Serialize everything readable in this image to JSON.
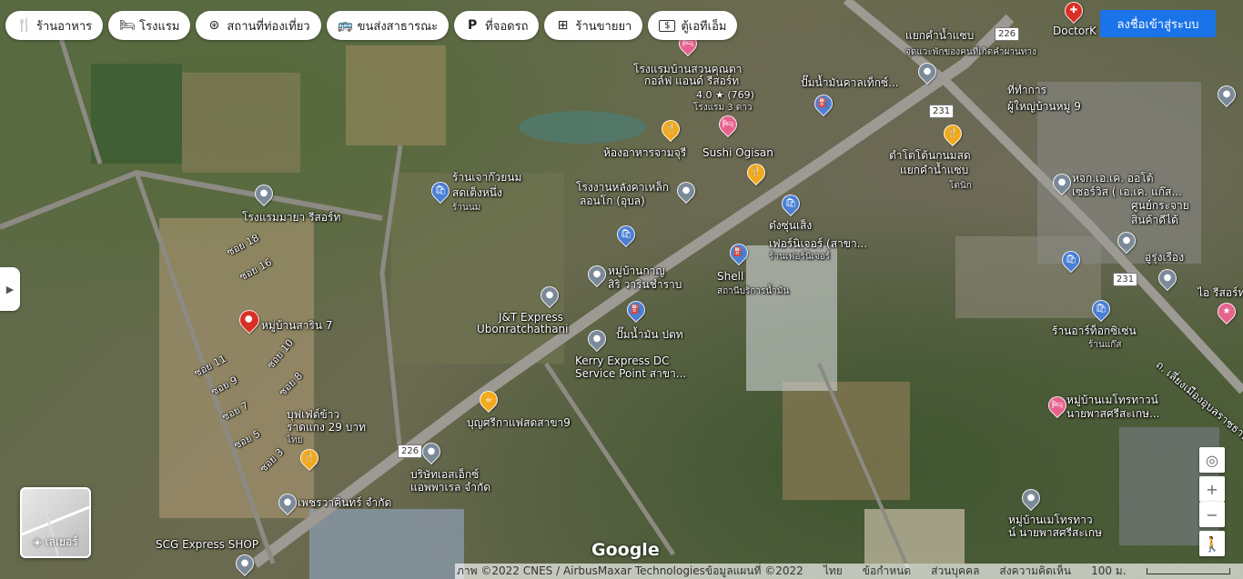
{
  "chips": [
    {
      "icon": "🍴",
      "label": "ร้านอาหาร",
      "name": "restaurant"
    },
    {
      "icon": "🛏",
      "label": "โรงแรม",
      "name": "hotel"
    },
    {
      "icon": "⊛",
      "label": "สถานที่ท่องเที่ยว",
      "name": "attractions"
    },
    {
      "icon": "🚌",
      "label": "ขนส่งสาธารณะ",
      "name": "transit"
    },
    {
      "icon": "P",
      "label": "ที่จอดรถ",
      "name": "parking"
    },
    {
      "icon": "⊞",
      "label": "ร้านขายยา",
      "name": "pharmacy"
    },
    {
      "icon": "$",
      "label": "ตู้เอทีเอ็ม",
      "name": "atm"
    }
  ],
  "signin_label": "ลงชื่อเข้าสู่ระบบ",
  "layers_label": "เลเยอร์",
  "google_logo": "Google",
  "attribution": {
    "imagery": "ภาพ ©2022 CNES / AirbusMaxar Technologiesข้อมูลแผนที่ ©2022",
    "lang": "ไทย",
    "terms": "ข้อกำหนด",
    "privacy": "ส่วนบุคคล",
    "feedback": "ส่งความคิดเห็น",
    "scale": "100 ม."
  },
  "shields": [
    "226",
    "231",
    "231",
    "226"
  ],
  "places": {
    "p1": "โรงแรมบ้านสวนคุณตา",
    "p1b": "กอล์ฟ แอนด์ รีสอร์ท",
    "p1c": "4.0 ★ (769)",
    "p1d": "โรงแรม 3 ดาว",
    "p2": "ห้องอาหารจามจุรี",
    "p3": "Sushi Ogisan",
    "p4": "ร้านเจาก๊วยนม",
    "p4b": "สดเต็งหนึ่ง",
    "p4c": "ร้านนม",
    "p5": "โรงงานหลังคาเหล็ก",
    "p5b": "ลอนโก (อุบล)",
    "p6": "โรงแรมมายา รีสอร์ท",
    "p7": "ต๋งซุ่นเส็ง",
    "p7b": "เฟอร์นิเจอร์ (สาขา...",
    "p7c": "ร้านเฟอร์นิเจอร์",
    "p8": "หมู่บ้านกาญ",
    "p8b": "สิริ วารินชำราบ",
    "p9": "Shell",
    "p9b": "สถานีบริการน้ำมัน",
    "p10": "J&T Express",
    "p10b": "Ubonratchathani",
    "p11": "ปั๊มน้ำมัน ปตท",
    "p12": "Kerry Express DC",
    "p12b": "Service Point สาขา...",
    "p13": "หมู่บ้านสาริน 7",
    "p14": "บุญศรีกาแฟสดสาขา9",
    "p15": "บุฟเฟ่ต์ข้าว",
    "p15b": "ราดแกง 29 บาท",
    "p15c": "ไทย",
    "p16": "บริษัทเอสเอ็กซ์",
    "p16b": "แอพพาเรล จำกัด",
    "p17": "เพชรวาคินทร์ จำกัด",
    "p18": "SCG Express SHOP",
    "p19": "แยกคำน้ำแซบ",
    "p19b": "จุดแวะพักของคนที่เกิดคำผ่านทาง",
    "p20": "ปั๊มน้ำมันคาลเท็กซ์...",
    "p21": "ที่ทำการ",
    "p21b": "ผู้ใหญ่บ้านหมู่ 9",
    "p22": "ตำโตโต้นกนมสด",
    "p22b": "แยกคำน้ำแซบ",
    "p22c": "โตนิก",
    "p23": "หจก.เอ.เค. ออโต้",
    "p23b": "เซอร์วิส ( เอ.เค. แก๊ส...",
    "p24": "ศูนย์กระจาย",
    "p24b": "สินค้าดีได้",
    "p25": "อู่รุ่งเรือง",
    "p26": "ไอ รีสอร์ท",
    "p27": "ร้านอาร์ท็อกซิเซ่น",
    "p27b": "ร้านแก๊ส",
    "p28": "ถ. เลี่ยงเมืองอุบลราชธานี",
    "p29": "หมู่บ้านเมโทรทาวน์",
    "p29b": "นายพาสศรีสะเกษ...",
    "p30": "หมู่บ้านเมโทรทาว",
    "p30b": "น์ นายพาสศรีสะเกษ",
    "p31": "DoctorK",
    "soi": [
      "ซอย 18",
      "ซอย 16",
      "ซอย 11",
      "ซอย 10",
      "ซอย 9",
      "ซอย 8",
      "ซอย 7",
      "ซอย 5",
      "ซอย 3"
    ]
  }
}
